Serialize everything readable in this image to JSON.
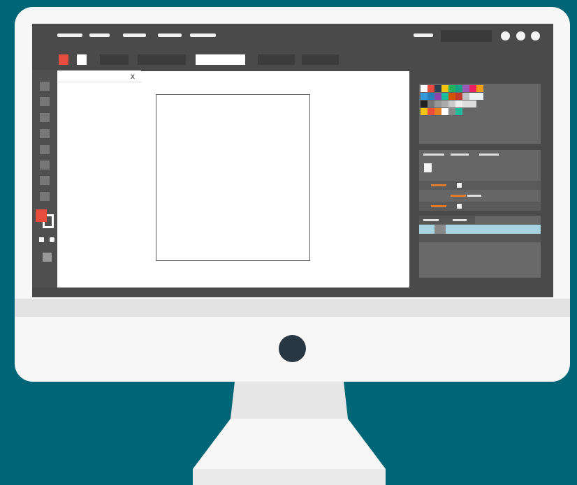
{
  "colors": {
    "background": "#006677",
    "monitor": "#f7f7f7",
    "screen": "#4a4a4a",
    "accent_red": "#e74c3c",
    "accent_orange": "#e07b2c",
    "layer_highlight": "#a8d3e3",
    "power_button": "#293743"
  },
  "document": {
    "tab_close": "x"
  },
  "swatches": [
    [
      "#ffffff",
      "#e74c3c",
      "#2c3e50",
      "#f1c40f",
      "#27ae60",
      "#16a085",
      "#9b59b6",
      "#e91e63",
      "#f39c12"
    ],
    [
      "#3498db",
      "#2980b9",
      "#8e44ad",
      "#1abc9c",
      "#d35400",
      "#c0392b",
      "#bdc3c7",
      "#ecf0f1",
      "#ecf0f1"
    ],
    [
      "#222222",
      "#777777",
      "#999999",
      "#aaaaaa",
      "#cccccc",
      "#eeeeee",
      "#dddddd",
      "#dddddd",
      "#666666"
    ],
    [
      "#f1c40f",
      "#e74c3c",
      "#e67e22",
      "#ffffff",
      "#888888",
      "#1abc9c",
      "#666666",
      "#666666",
      "#666666"
    ]
  ],
  "icons": {
    "window_controls": [
      "minimize-icon",
      "maximize-icon",
      "close-icon"
    ],
    "fill_color": "fill-color-icon",
    "stroke_color": "stroke-color-icon"
  }
}
